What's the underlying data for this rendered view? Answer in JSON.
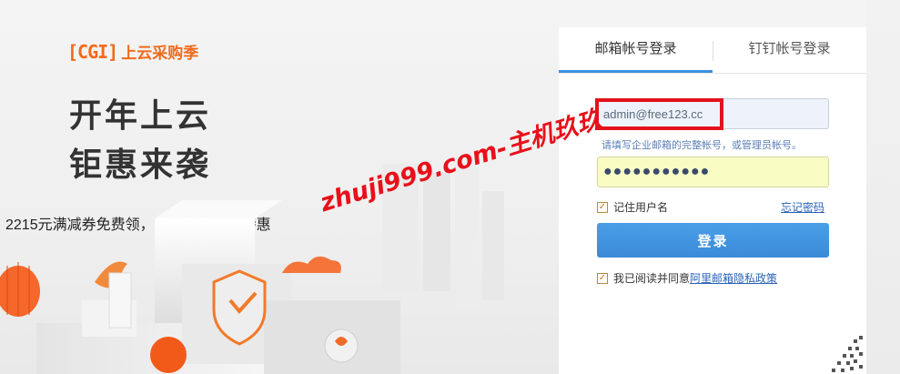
{
  "logo": {
    "mark": "[CGI]",
    "text": "上云采购季"
  },
  "hero": {
    "title_line1": "开年上云",
    "title_line2": "钜惠来袭",
    "subtitle": "2215元满减券免费领，百款产品专享特惠"
  },
  "watermark": "zhuji999.com-主机玖玖",
  "login": {
    "tabs": [
      {
        "label": "邮箱帐号登录",
        "active": true
      },
      {
        "label": "钉钉帐号登录",
        "active": false
      }
    ],
    "email_value": "admin@free123.cc",
    "hint": "请填写企业邮箱的完整帐号，或管理员帐号。",
    "password_mask": "●●●●●●●●●●●",
    "remember_label": "记住用户名",
    "forgot_label": "忘记密码",
    "login_button": "登录",
    "agree_prefix": "我已阅读并同意",
    "agree_link": "阿里邮箱隐私政策"
  },
  "colors": {
    "brand": "#f26a1b",
    "accent": "#3c8fe0",
    "highlight": "#e3121c"
  }
}
